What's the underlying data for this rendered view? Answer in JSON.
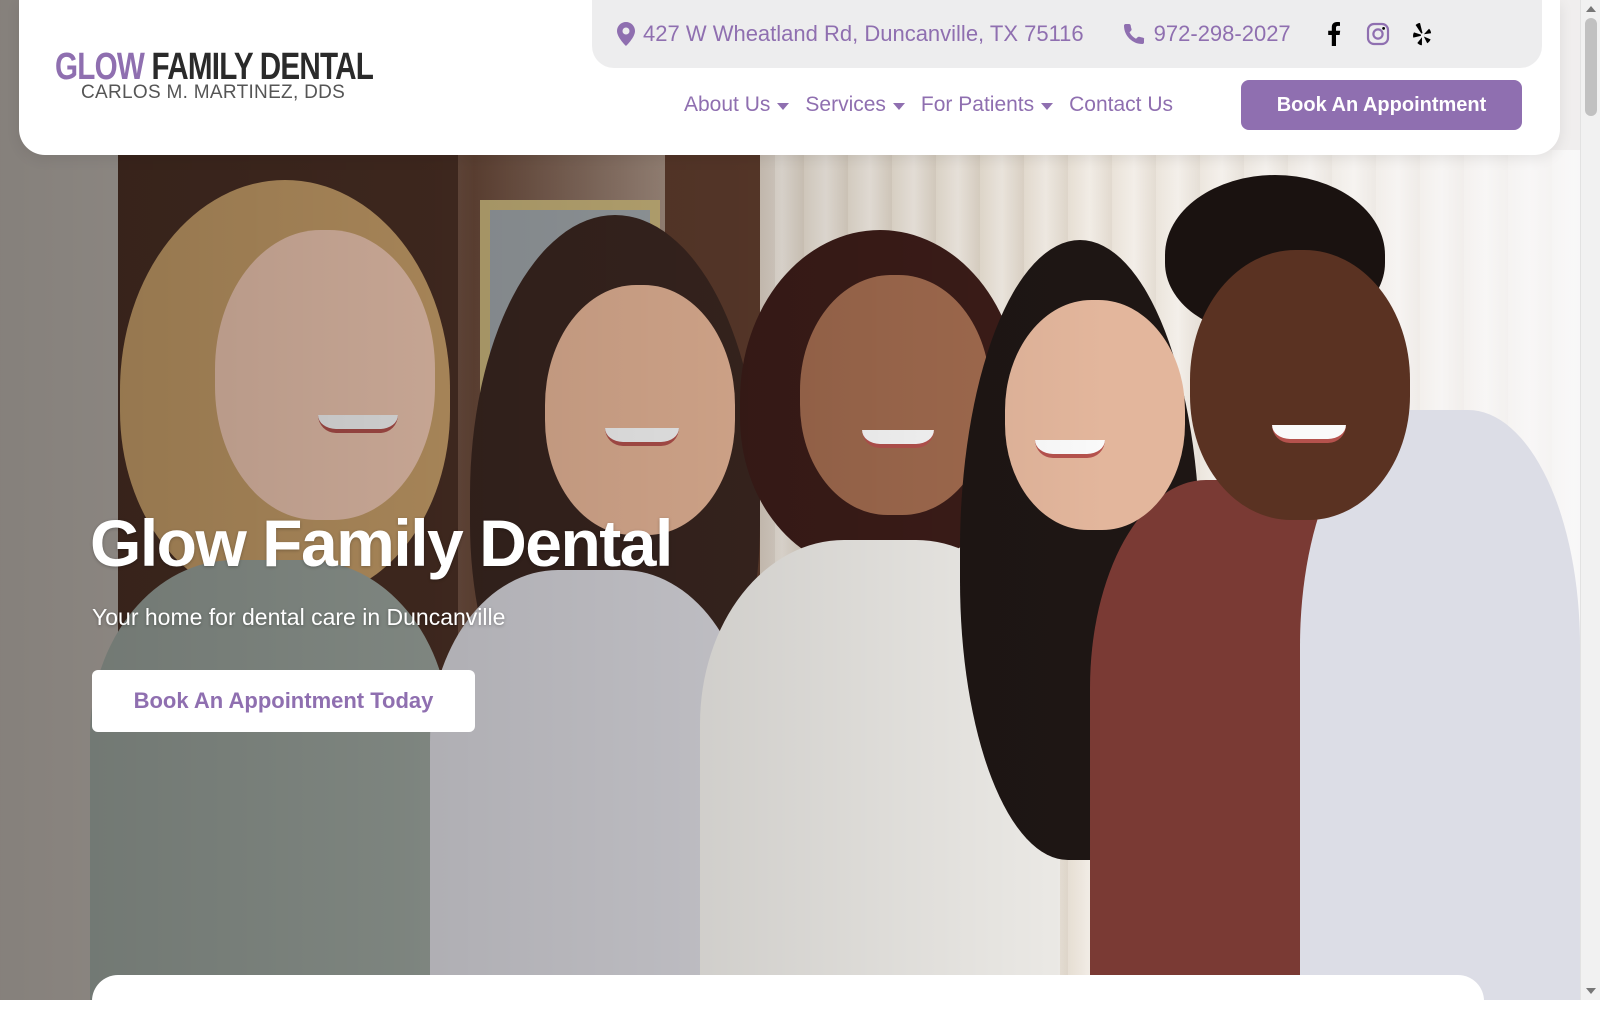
{
  "brand": {
    "logo_glow": "GLOW",
    "logo_rest": "FAMILY DENTAL",
    "logo_sub": "CARLOS M. MARTINEZ, DDS"
  },
  "topbar": {
    "address": "427 W Wheatland Rd, Duncanville, TX 75116",
    "phone": "972-298-2027",
    "social": [
      "facebook-icon",
      "instagram-icon",
      "yelp-icon"
    ]
  },
  "nav": {
    "items": [
      {
        "label": "About Us",
        "has_dropdown": true
      },
      {
        "label": "Services",
        "has_dropdown": true
      },
      {
        "label": "For Patients",
        "has_dropdown": true
      },
      {
        "label": "Contact Us",
        "has_dropdown": false
      }
    ],
    "cta_label": "Book An Appointment"
  },
  "hero": {
    "title": "Glow Family Dental",
    "subtitle": "Your home for dental care in Duncanville",
    "cta_label": "Book An Appointment Today"
  },
  "colors": {
    "brand_purple": "#8f6fb0",
    "dark_text": "#2a2a2a",
    "topbar_bg": "#ededee",
    "white": "#ffffff"
  }
}
